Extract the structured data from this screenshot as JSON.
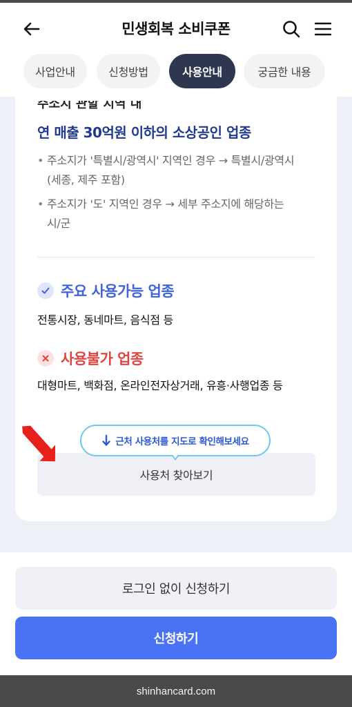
{
  "header": {
    "title": "민생회복 소비쿠폰",
    "back_icon": "arrow-left-icon",
    "search_icon": "search-icon",
    "menu_icon": "hamburger-menu-icon"
  },
  "tabs": [
    {
      "label": "사업안내",
      "active": false
    },
    {
      "label": "신청방법",
      "active": false
    },
    {
      "label": "사용안내",
      "active": true
    },
    {
      "label": "궁금한 내용",
      "active": false
    }
  ],
  "content": {
    "cut_text": "주소지 관할 지역 내",
    "headline": "연 매출 30억원 이하의 소상공인 업종",
    "bullets": [
      {
        "dot": "•",
        "text": "주소지가 '특별시/광역시' 지역인 경우 → 특별시/광역시(세종, 제주 포함)"
      },
      {
        "dot": "•",
        "text": "주소지가 '도' 지역인 경우 → 세부 주소지에 해당하는 시/군"
      }
    ],
    "usable": {
      "title": "주요 사용가능 업종",
      "body": "전통시장, 동네마트, 음식점 등"
    },
    "unusable": {
      "title": "사용불가 업종",
      "body": "대형마트, 백화점, 온라인전자상거래, 유흥·사행업종 등"
    },
    "tooltip": "근처 사용처를 지도로 확인해보세요",
    "find_button": "사용처 찾아보기"
  },
  "footer": {
    "nologin_button": "로그인 없이 신청하기",
    "apply_button": "신청하기",
    "url": "shinhancard.com"
  },
  "colors": {
    "tab_active": "#2e3650",
    "headline": "#1f3a8f",
    "usable": "#3e63dd",
    "unusable": "#e0443e",
    "apply_button": "#4a72f5",
    "annotation_arrow": "#e8201c"
  }
}
